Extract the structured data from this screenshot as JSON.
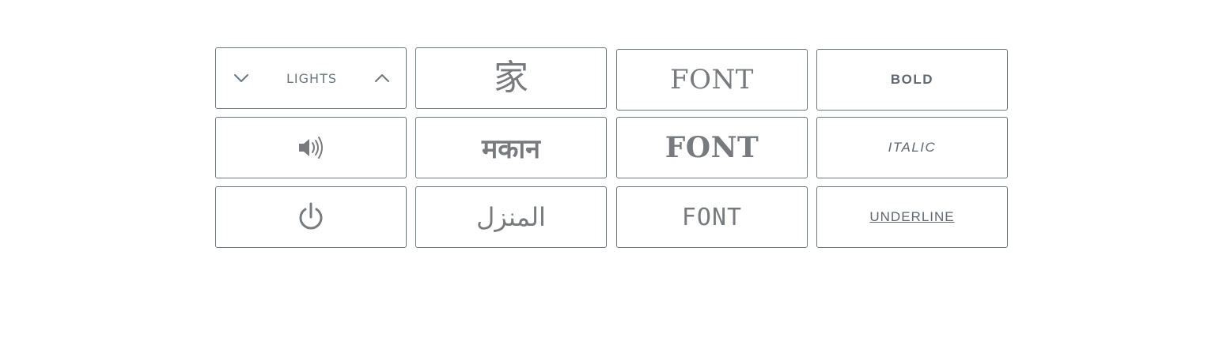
{
  "lights": {
    "label": "LIGHTS",
    "decrease_icon": "chevron-down-icon",
    "increase_icon": "chevron-up-icon"
  },
  "language_buttons": [
    {
      "label": "家",
      "language": "chinese"
    },
    {
      "label": "मकान",
      "language": "hindi"
    },
    {
      "label": "المنزل",
      "language": "arabic"
    }
  ],
  "font_buttons": [
    {
      "label": "FONT",
      "style": "serif-light"
    },
    {
      "label": "FONT",
      "style": "serif-bold"
    },
    {
      "label": "FONT",
      "style": "monospace"
    }
  ],
  "text_style_buttons": {
    "bold": "BOLD",
    "italic": "ITALIC",
    "underline": "UNDERLINE"
  },
  "icon_buttons": {
    "volume": "volume-icon",
    "power": "power-icon"
  },
  "colors": {
    "border": "#6b767e",
    "text": "#777b80",
    "background": "#ffffff"
  }
}
